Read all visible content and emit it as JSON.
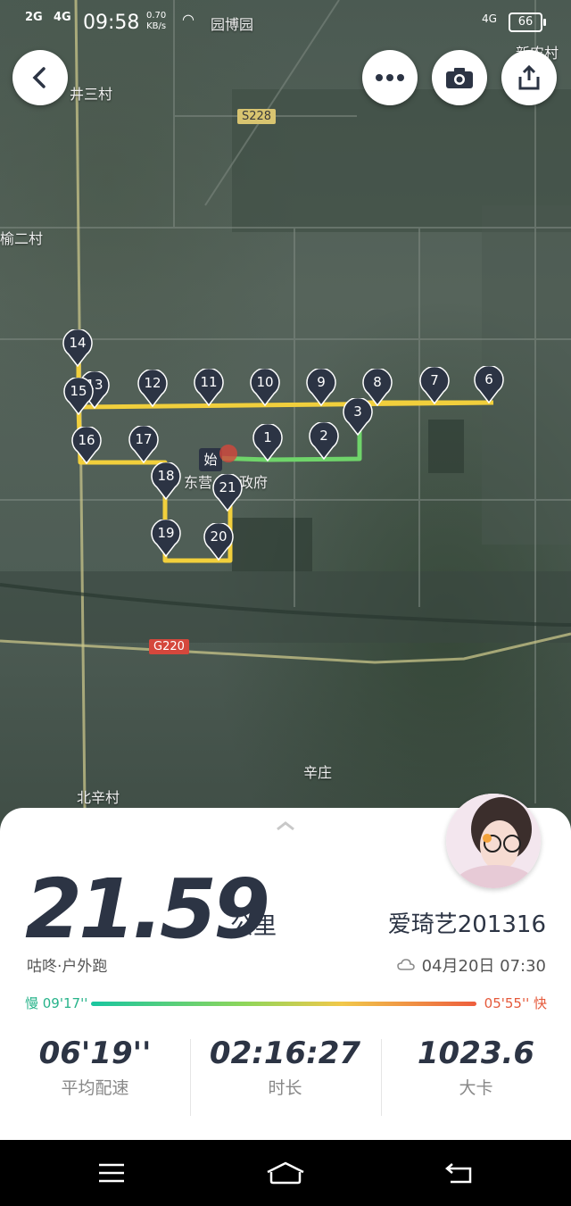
{
  "status_bar": {
    "signal1": "2G",
    "signal2": "4G",
    "time": "09:58",
    "speed_value": "0.70",
    "speed_unit": "KB/s",
    "net": "4G",
    "battery": "66"
  },
  "toolbar": {
    "back_icon": "chevron-left-icon",
    "more_icon": "more-dots-icon",
    "camera_icon": "camera-icon",
    "share_icon": "share-icon"
  },
  "map": {
    "labels": [
      "园博园",
      "井三村",
      "新农村",
      "榆二村",
      "东营",
      "政府",
      "辛庄",
      "北辛村"
    ],
    "road_signs": [
      "S228",
      "G220"
    ],
    "start_marker": "始",
    "markers": [
      "1",
      "2",
      "3",
      "6",
      "7",
      "8",
      "9",
      "10",
      "11",
      "12",
      "13",
      "14",
      "15",
      "16",
      "17",
      "18",
      "19",
      "20",
      "21"
    ]
  },
  "summary": {
    "distance": "21.59",
    "unit": "公里",
    "username": "爱琦艺201316",
    "source": "咕咚·户外跑",
    "datetime": "04月20日 07:30",
    "pace_slow": "慢 09'17''",
    "pace_fast": "05'55'' 快",
    "stats": [
      {
        "value": "06'19''",
        "label": "平均配速"
      },
      {
        "value": "02:16:27",
        "label": "时长"
      },
      {
        "value": "1023.6",
        "label": "大卡"
      }
    ]
  },
  "colors": {
    "route_yellow": "#f1cf3c",
    "route_green": "#6fd46a",
    "marker_fill": "#2c3444",
    "text_dark": "#2c3444"
  }
}
